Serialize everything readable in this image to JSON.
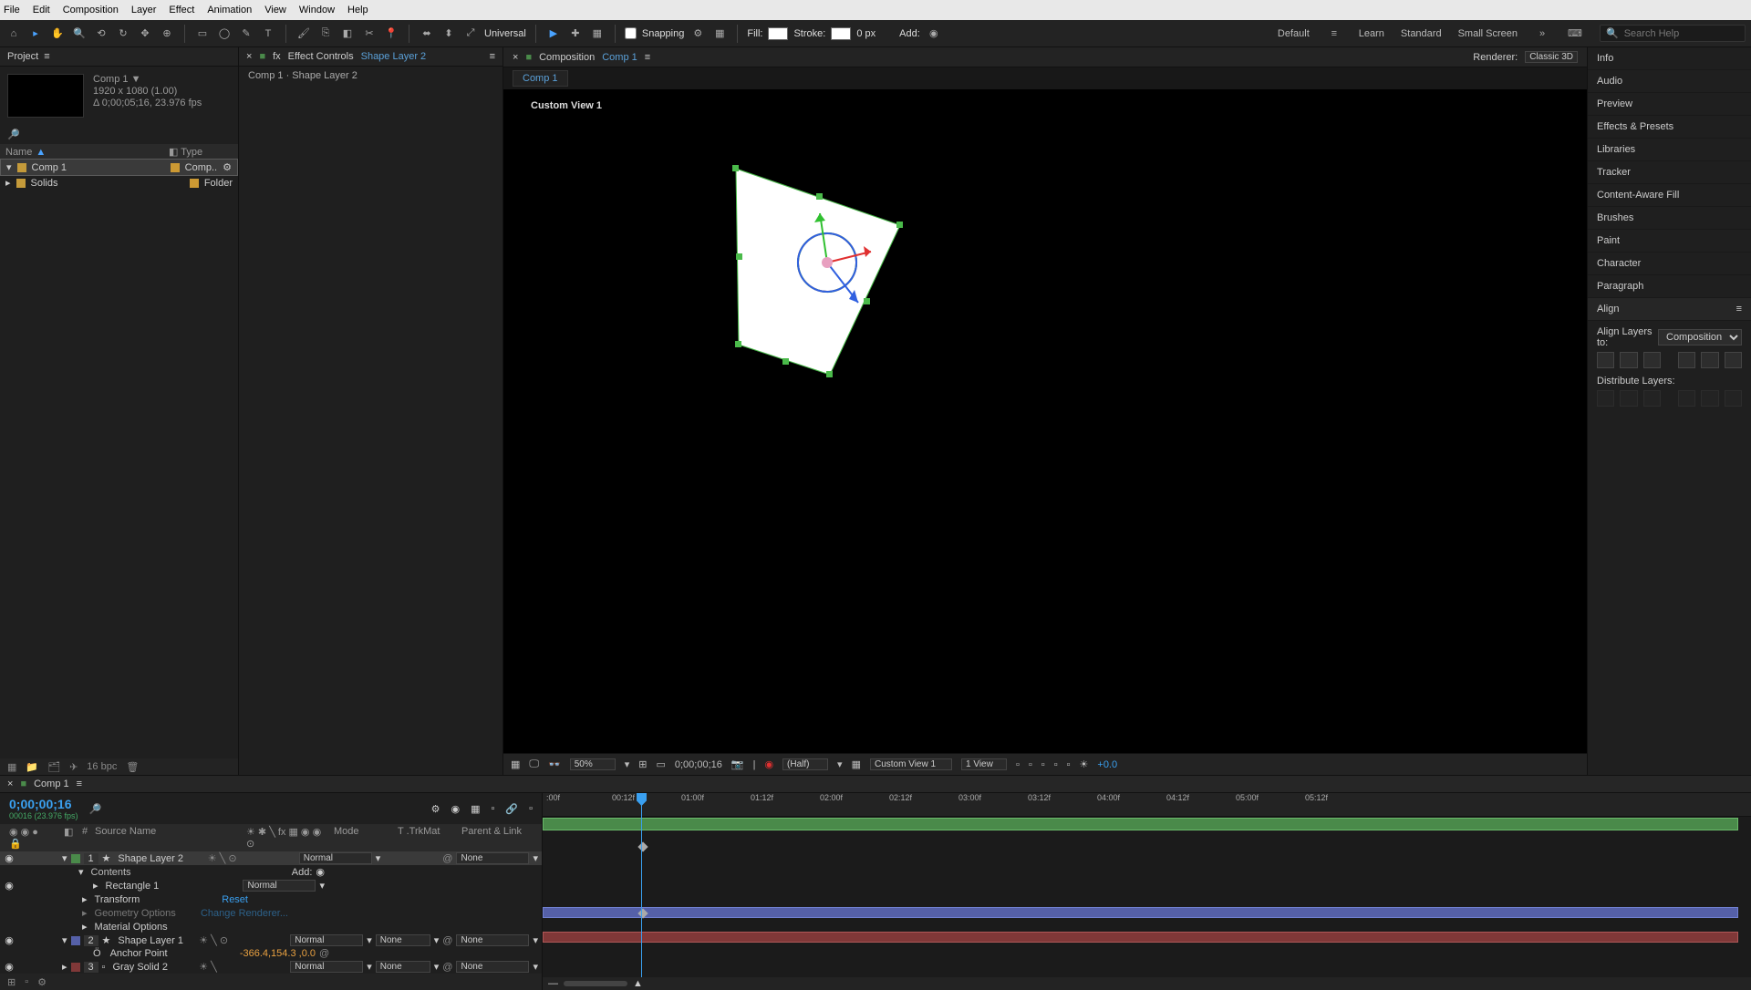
{
  "menu": [
    "File",
    "Edit",
    "Composition",
    "Layer",
    "Effect",
    "Animation",
    "View",
    "Window",
    "Help"
  ],
  "toolbar": {
    "snapping": "Snapping",
    "fill": "Fill:",
    "stroke": "Stroke:",
    "stroke_px": "0 px",
    "add": "Add:",
    "workspaces": [
      "Default",
      "Learn",
      "Standard",
      "Small Screen"
    ],
    "search_ph": "Search Help",
    "universal": "Universal"
  },
  "project": {
    "tab": "Project",
    "comp_name": "Comp 1",
    "dims": "1920 x 1080 (1.00)",
    "dur": "Δ 0;00;05;16, 23.976 fps",
    "name_col": "Name",
    "type_col": "Type",
    "items": [
      {
        "name": "Comp 1",
        "type": "Comp..",
        "color": "#c49a3a"
      },
      {
        "name": "Solids",
        "type": "Folder",
        "color": "#c49a3a"
      }
    ],
    "bpc": "16 bpc"
  },
  "effects": {
    "tab": "Effect Controls",
    "target": "Shape Layer 2",
    "path": "Comp 1 · Shape Layer 2"
  },
  "viewer": {
    "tab": "Composition",
    "comp": "Comp 1",
    "subtab": "Comp 1",
    "renderer_lbl": "Renderer:",
    "renderer": "Classic 3D",
    "view_label": "Custom View 1",
    "zoom": "50%",
    "time": "0;00;00;16",
    "res": "(Half)",
    "camera": "Custom View 1",
    "views": "1 View",
    "exposure": "+0.0"
  },
  "right_panels": [
    "Info",
    "Audio",
    "Preview",
    "Effects & Presets",
    "Libraries",
    "Tracker",
    "Content-Aware Fill",
    "Brushes",
    "Paint",
    "Character",
    "Paragraph"
  ],
  "align": {
    "title": "Align",
    "layers_to": "Align Layers to:",
    "target": "Composition",
    "distribute": "Distribute Layers:"
  },
  "timeline": {
    "tab": "Comp 1",
    "tc": "0;00;00;16",
    "tc_sub": "00016 (23.976 fps)",
    "cols": {
      "source": "Source Name",
      "mode": "Mode",
      "trkmat": "T .TrkMat",
      "parent": "Parent & Link"
    },
    "add": "Add:",
    "layers": [
      {
        "n": 1,
        "name": "Shape Layer 2",
        "color": "#4a8a4a",
        "mode": "Normal",
        "trk": "",
        "par": "None",
        "sel": true
      },
      {
        "n": 2,
        "name": "Shape Layer 1",
        "color": "#5560a8",
        "mode": "Normal",
        "trk": "None",
        "par": "None"
      },
      {
        "n": 3,
        "name": "Gray Solid 2",
        "color": "#803838",
        "mode": "Normal",
        "trk": "None",
        "par": "None"
      }
    ],
    "props": {
      "contents": "Contents",
      "rect": "Rectangle 1",
      "rect_mode": "Normal",
      "transform": "Transform",
      "reset": "Reset",
      "geom": "Geometry Options",
      "change_renderer": "Change Renderer...",
      "material": "Material Options",
      "anchor": "Anchor Point",
      "anchor_val": "-366.4,154.3 ,0.0"
    },
    "ticks": [
      ":00f",
      "00:12f",
      "01:00f",
      "01:12f",
      "02:00f",
      "02:12f",
      "03:00f",
      "03:12f",
      "04:00f",
      "04:12f",
      "05:00f",
      "05:12f"
    ]
  }
}
